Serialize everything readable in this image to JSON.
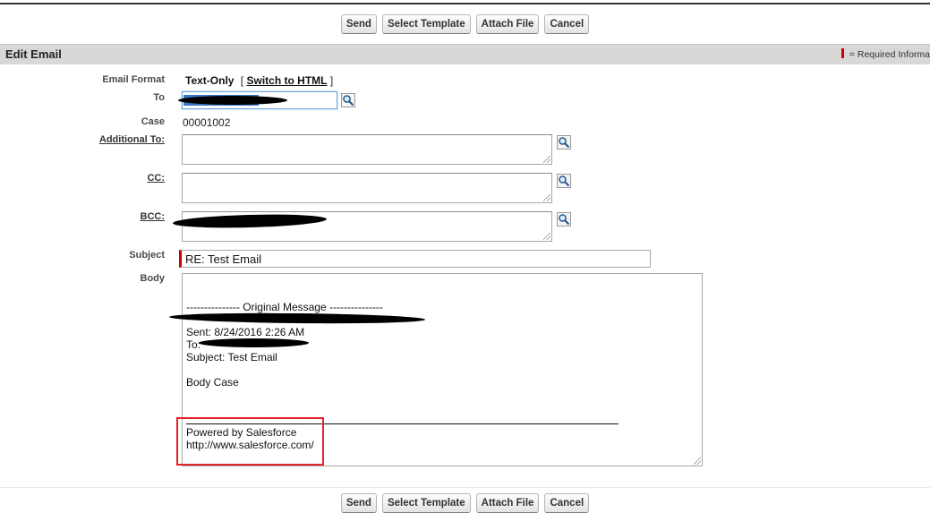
{
  "toolbar": {
    "send": "Send",
    "select_template": "Select Template",
    "attach_file": "Attach File",
    "cancel": "Cancel"
  },
  "section": {
    "title": "Edit Email",
    "required_legend": "= Required Informa"
  },
  "fields": {
    "email_format_label": "Email Format",
    "email_format_value": "Text-Only",
    "bracket_open": "[",
    "switch_link": "Switch to HTML",
    "bracket_close": "]",
    "to_label": "To",
    "case_label": "Case",
    "case_value": "00001002",
    "additional_to_label": "Additional To:",
    "cc_label": "CC:",
    "bcc_label": "BCC:",
    "subject_label": "Subject",
    "subject_value": "RE: Test Email",
    "body_label": "Body"
  },
  "body_lines": {
    "original": "--------------- Original Message ---------------",
    "sent": "Sent: 8/24/2016 2:26 AM",
    "to": "To:",
    "subject": "Subject: Test Email",
    "body_case": "Body Case",
    "powered": "Powered by Salesforce",
    "url": "http://www.salesforce.com/"
  },
  "colors": {
    "required": "#cc0000",
    "highlight_box": "#e3232b",
    "header_bg": "#d8d8d8"
  },
  "icons": {
    "lookup": "magnifier-lookup-icon"
  }
}
